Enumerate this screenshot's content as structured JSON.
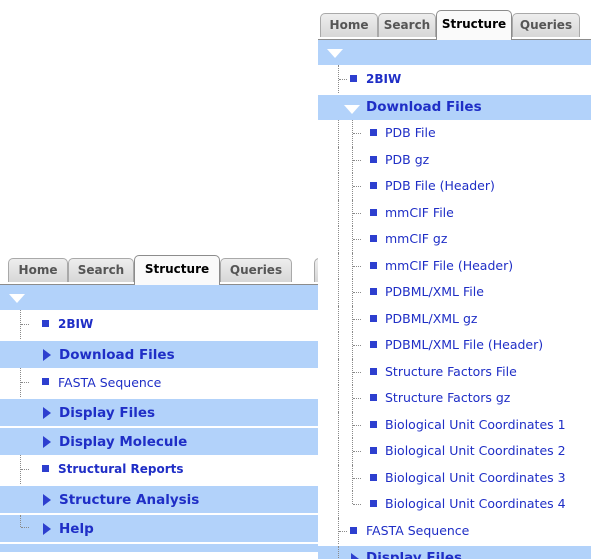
{
  "tabs": [
    "Home",
    "Search",
    "Structure",
    "Queries"
  ],
  "active_tab": "Structure",
  "left_panel": {
    "items": [
      {
        "label": "2BIW",
        "type": "item",
        "weight": "bold"
      },
      {
        "label": "Download Files",
        "type": "section",
        "state": "collapsed"
      },
      {
        "label": "FASTA Sequence",
        "type": "item"
      },
      {
        "label": "Display Files",
        "type": "section",
        "state": "collapsed"
      },
      {
        "label": "Display Molecule",
        "type": "section",
        "state": "collapsed"
      },
      {
        "label": "Structural Reports",
        "type": "item",
        "weight": "bold"
      },
      {
        "label": "Structure Analysis",
        "type": "section",
        "state": "collapsed"
      },
      {
        "label": "Help",
        "type": "section",
        "state": "collapsed"
      }
    ]
  },
  "right_panel": {
    "root_item": "2BIW",
    "expanded_section": "Download Files",
    "download_files": [
      "PDB File",
      "PDB gz",
      "PDB File (Header)",
      "mmCIF File",
      "mmCIF gz",
      "mmCIF File (Header)",
      "PDBML/XML File",
      "PDBML/XML gz",
      "PDBML/XML File (Header)",
      "Structure Factors File",
      "Structure Factors gz",
      "Biological Unit Coordinates 1",
      "Biological Unit Coordinates 2",
      "Biological Unit Coordinates 3",
      "Biological Unit Coordinates 4"
    ],
    "after_items": [
      {
        "label": "FASTA Sequence",
        "type": "item"
      },
      {
        "label": "Display Files",
        "type": "section",
        "state": "collapsed"
      }
    ]
  },
  "colors": {
    "section_bg": "#b2d2fa",
    "link": "#1f2ec6",
    "bullet": "#2d3fcf"
  },
  "icons": {
    "expanded": "triangle-down-icon",
    "collapsed": "triangle-right-icon",
    "leaf": "square-bullet-icon"
  }
}
